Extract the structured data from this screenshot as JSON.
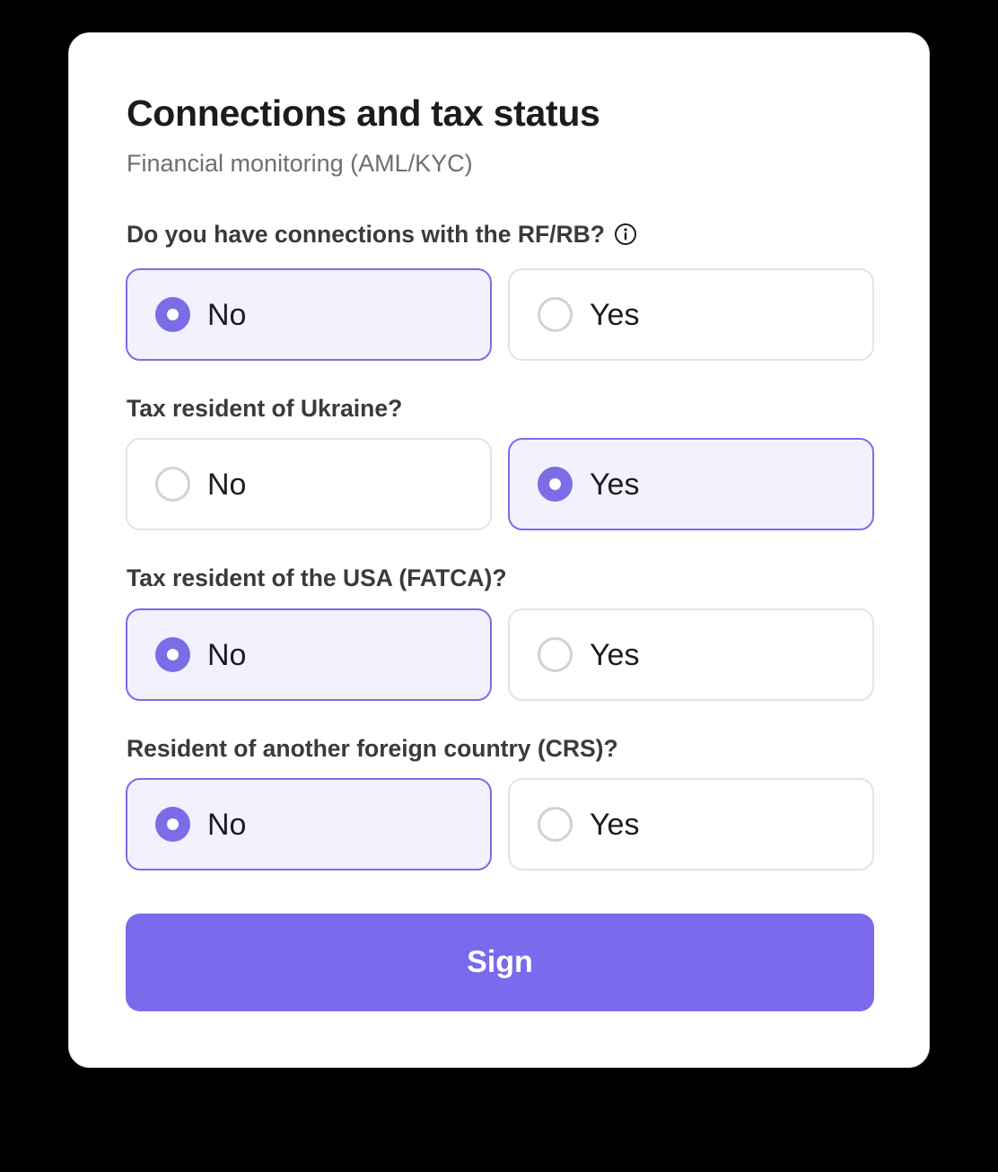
{
  "form": {
    "title": "Connections and tax status",
    "subtitle": "Financial monitoring (AML/KYC)",
    "accent_color": "#7b6aec",
    "selected_bg": "#f3f1fe",
    "questions": [
      {
        "text": "Do you have connections with the RF/RB?",
        "has_info_icon": true,
        "info_icon": "info-circle-icon",
        "options": [
          "No",
          "Yes"
        ],
        "selected": "No"
      },
      {
        "text": "Tax resident of Ukraine?",
        "has_info_icon": false,
        "options": [
          "No",
          "Yes"
        ],
        "selected": "Yes"
      },
      {
        "text": "Tax resident of the USA (FATCA)?",
        "has_info_icon": false,
        "options": [
          "No",
          "Yes"
        ],
        "selected": "No"
      },
      {
        "text": "Resident of another foreign country (CRS)?",
        "has_info_icon": false,
        "options": [
          "No",
          "Yes"
        ],
        "selected": "No"
      }
    ],
    "submit_label": "Sign"
  }
}
